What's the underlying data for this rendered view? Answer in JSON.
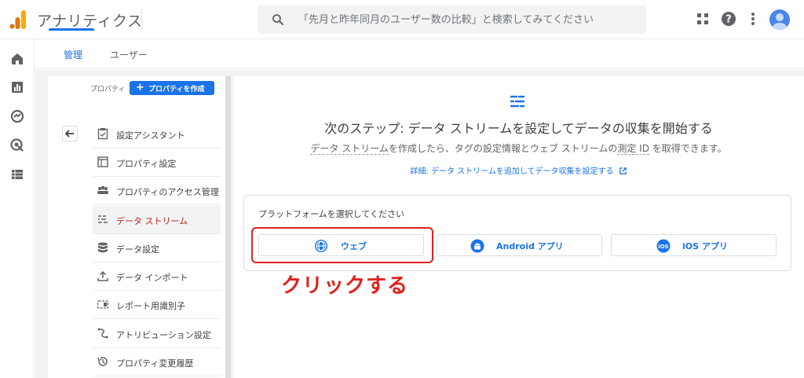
{
  "header": {
    "app_title": "アナリティクス",
    "search_placeholder": "「先月と昨年同月のユーザー数の比較」と検索してみてください"
  },
  "tabs": [
    {
      "label": "管理",
      "active": true
    },
    {
      "label": "ユーザー",
      "active": false
    }
  ],
  "property": {
    "label": "プロパティ",
    "create_button": "プロパティを作成"
  },
  "menu": [
    {
      "label": "設定アシスタント",
      "icon": "clipboard-check-icon",
      "active": false
    },
    {
      "label": "プロパティ設定",
      "icon": "window-icon",
      "active": false
    },
    {
      "label": "プロパティのアクセス管理",
      "icon": "people-icon",
      "active": false
    },
    {
      "label": "データ ストリーム",
      "icon": "data-stream-icon",
      "active": true
    },
    {
      "label": "データ設定",
      "icon": "database-icon",
      "active": false
    },
    {
      "label": "データ インポート",
      "icon": "upload-icon",
      "active": false
    },
    {
      "label": "レポート用識別子",
      "icon": "identifier-icon",
      "active": false
    },
    {
      "label": "アトリビューション設定",
      "icon": "attribution-icon",
      "active": false
    },
    {
      "label": "プロパティ変更履歴",
      "icon": "history-icon",
      "active": false
    }
  ],
  "main": {
    "heading": "次のステップ: データ ストリームを設定してデータの収集を開始する",
    "sub_pre": "データ ストリーム",
    "sub_mid1": "を作成したら、タグの設定情報とウェブ ストリームの",
    "sub_u2": "測定 ID",
    "sub_post": " を取得できます。",
    "learn_link": "詳細: データ ストリームを追加してデータ収集を設定する",
    "platform_title": "プラットフォームを選択してください",
    "platforms": [
      {
        "label": "ウェブ",
        "icon": "globe-icon"
      },
      {
        "label": "Android アプリ",
        "icon": "android-icon"
      },
      {
        "label": "iOS アプリ",
        "icon": "ios-icon"
      }
    ],
    "annotation": "クリックする"
  },
  "colors": {
    "accent": "#1a73e8",
    "active_menu": "#c5221f",
    "annotation": "#e0211d"
  }
}
